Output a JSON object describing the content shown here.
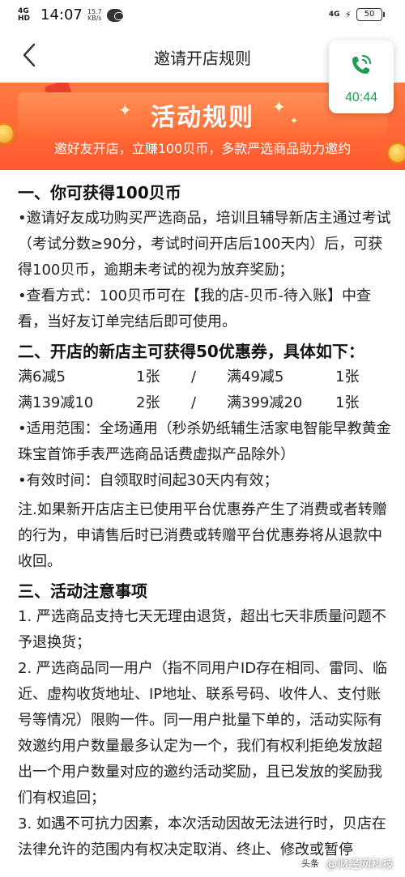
{
  "status_bar": {
    "signal": "4G HD",
    "time": "14:07",
    "net_speed_value": "15.7",
    "net_speed_unit": "KB/s",
    "network_right": "4G",
    "battery": "50"
  },
  "nav": {
    "title": "邀请开店规则"
  },
  "call_widget": {
    "duration": "40:44"
  },
  "banner": {
    "title": "活动规则",
    "subtitle": "邀好友开店，立赚100贝币，多款严选商品助力邀约"
  },
  "section1": {
    "title": "一、你可获得100贝币",
    "p1": "•邀请好友成功购买严选商品，培训且辅导新店主通过考试（考试分数≥90分，考试时间开店后100天内）后，可获得100贝币，逾期未考试的视为放弃奖励；",
    "p2": "•查看方式：100贝币可在【我的店-贝币-待入账】中查看，当好友订单完结后即可使用。"
  },
  "section2": {
    "title": "二、开店的新店主可获得50优惠券，具体如下：",
    "coupons": [
      [
        "满6减5",
        "1张",
        "/",
        "满49减5",
        "1张"
      ],
      [
        "满139减10",
        "2张",
        "/",
        "满399减20",
        "1张"
      ]
    ],
    "scope": "•适用范围：全场通用（秒杀奶纸辅生活家电智能早教黄金珠宝首饰手表严选商品话费虚拟产品除外）",
    "validity": "•有效时间：自领取时间起30天内有效；",
    "note": "注.如果新开店店主已使用平台优惠券产生了消费或者转赠的行为，申请售后时已消费或转赠平台优惠券将从退款中收回。"
  },
  "section3": {
    "title": "三、活动注意事项",
    "item1": "1. 严选商品支持七天无理由退货，超出七天非质量问题不予退换货；",
    "item2": "2. 严选商品同一用户（指不同用户ID存在相同、雷同、临近、虚构收货地址、IP地址、联系号码、收件人、支付账号等情况）限购一件。同一用户批量下单的，活动实际有效邀约用户数量最多认定为一个，我们有权利拒绝发放超出一个用户数量对应的邀约活动奖励，且已发放的奖励我们有权追回；",
    "item3": "3. 如遇不可抗力因素，本次活动因故无法进行时，贝店在法律允许的范围内有权决定取消、终止、修改或暂停"
  },
  "watermark": {
    "logo": "头条",
    "text": "@财经网科技"
  },
  "colors": {
    "banner_orange": "#ff5a2c",
    "call_green": "#1f9d55"
  }
}
